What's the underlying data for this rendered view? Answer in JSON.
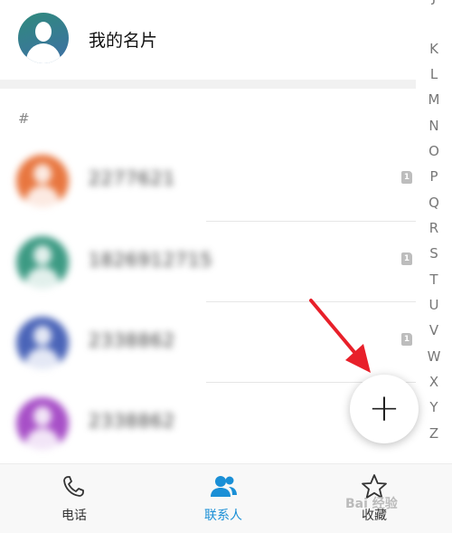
{
  "my_card": {
    "title": "我的名片"
  },
  "section": {
    "letter": "#"
  },
  "contacts": [
    {
      "name": "2277621",
      "avatar_color": "#e8763f",
      "sim": "1"
    },
    {
      "name": "1826912715",
      "avatar_color": "#3c9a83",
      "sim": "1"
    },
    {
      "name": "2338862",
      "avatar_color": "#4a64b8",
      "sim": "1"
    },
    {
      "name": "2338862",
      "avatar_color": "#a74fc7",
      "sim": ""
    }
  ],
  "alphabet_index": [
    "J",
    "K",
    "L",
    "M",
    "N",
    "O",
    "P",
    "Q",
    "R",
    "S",
    "T",
    "U",
    "V",
    "W",
    "X",
    "Y",
    "Z"
  ],
  "fab": {
    "label": "+"
  },
  "bottom_nav": {
    "phone_label": "电话",
    "contacts_label": "联系人",
    "favorites_label": "收藏",
    "active": "contacts",
    "active_color": "#1a8fd6",
    "inactive_color": "#333333"
  },
  "watermark": "Bai 经验"
}
